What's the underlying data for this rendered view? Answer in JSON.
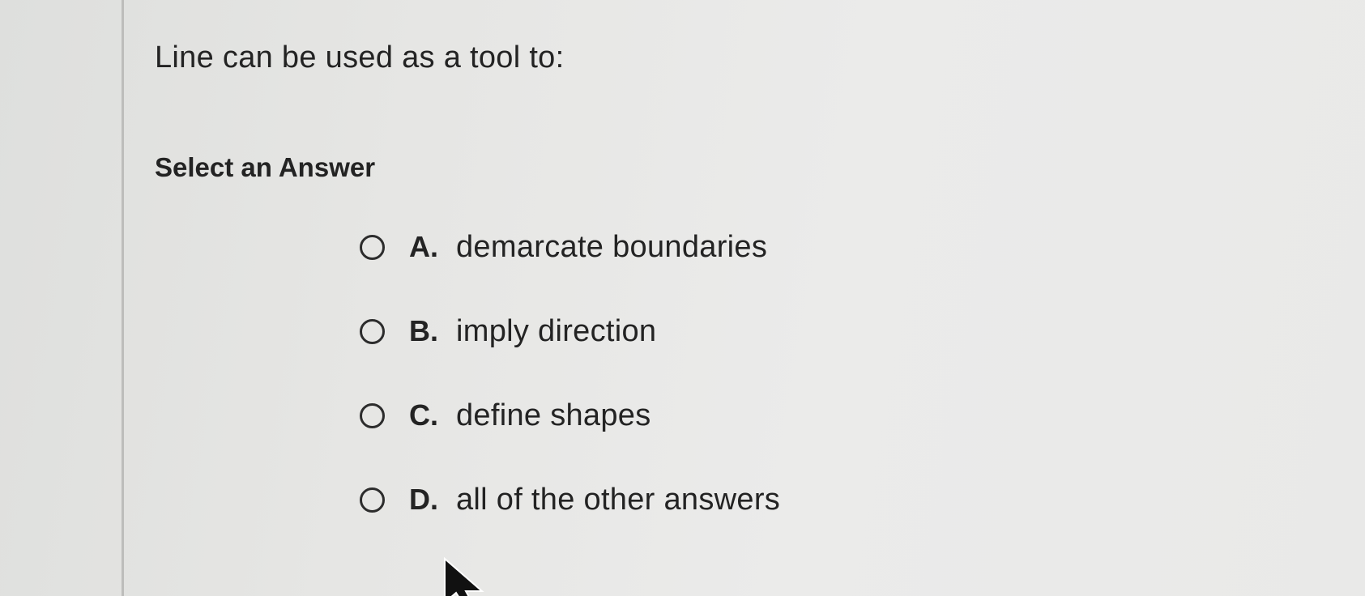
{
  "question": {
    "text": "Line can be used as a tool to:"
  },
  "prompt": {
    "select_label": "Select an Answer"
  },
  "options": [
    {
      "letter": "A.",
      "text": "demarcate boundaries",
      "selected": false
    },
    {
      "letter": "B.",
      "text": "imply direction",
      "selected": false
    },
    {
      "letter": "C.",
      "text": "define shapes",
      "selected": false
    },
    {
      "letter": "D.",
      "text": "all of the other answers",
      "selected": false
    }
  ],
  "icons": {
    "radio": "radio-unchecked-icon",
    "cursor": "mouse-pointer-icon"
  },
  "colors": {
    "background": "#e6e6e4",
    "text": "#232323",
    "divider": "#bdbdbb"
  }
}
